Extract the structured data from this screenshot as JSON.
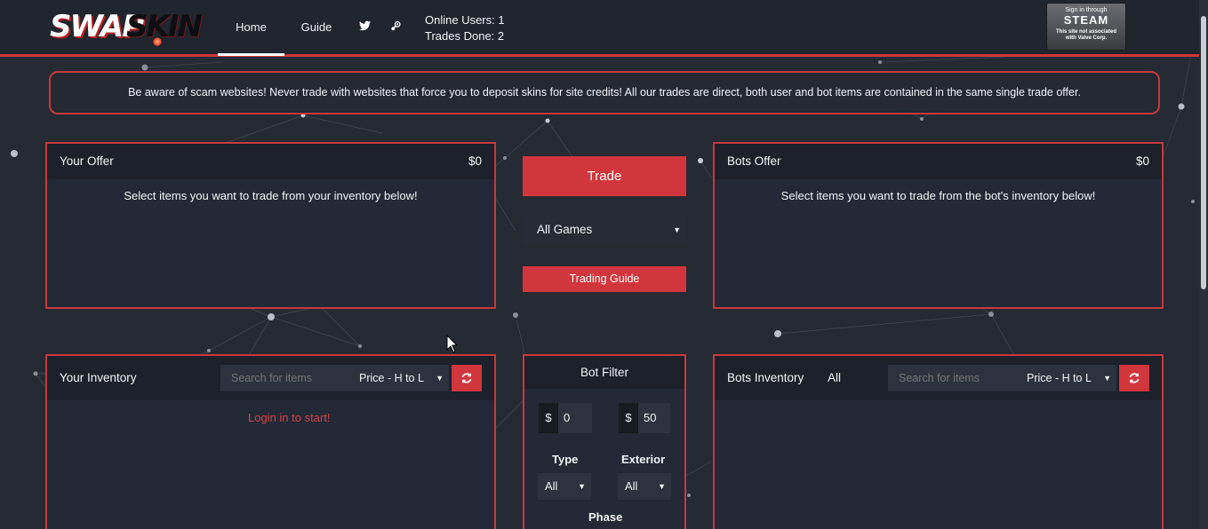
{
  "brand": {
    "logo_part_a": "SWAP",
    "logo_part_b": "SKIN"
  },
  "nav": {
    "home": "Home",
    "guide": "Guide",
    "twitter_icon": "twitter-icon",
    "steam_icon": "steam-icon"
  },
  "stats": {
    "online_users": "Online Users: 1",
    "trades_done": "Trades Done: 2"
  },
  "steam_login": {
    "line1": "Sign in through",
    "line2": "STEAM",
    "line3": "This site not associated",
    "line4": "with Valve Corp."
  },
  "warning": "Be aware of scam websites! Never trade with websites that force you to deposit skins for site credits! All our trades are direct, both user and bot items are contained in the same single trade offer.",
  "your_offer": {
    "title": "Your Offer",
    "amount": "$0",
    "message": "Select items you want to trade from your inventory below!"
  },
  "bots_offer": {
    "title": "Bots Offer",
    "amount": "$0",
    "message": "Select items you want to trade from the bot's inventory below!"
  },
  "middle": {
    "trade_button": "Trade",
    "games_select": "All Games",
    "trading_guide_button": "Trading Guide"
  },
  "your_inventory": {
    "title": "Your Inventory",
    "search_placeholder": "Search for items",
    "sort": "Price - H to L",
    "login_message": "Login in to start!"
  },
  "bot_filter": {
    "title": "Bot Filter",
    "currency": "$",
    "min_price": "0",
    "max_price": "50",
    "type_label": "Type",
    "type_value": "All",
    "exterior_label": "Exterior",
    "exterior_value": "All",
    "phase_label": "Phase"
  },
  "bots_inventory": {
    "title": "Bots Inventory",
    "filter_label": "All",
    "search_placeholder": "Search for items",
    "sort": "Price - H to L"
  },
  "colors": {
    "accent": "#d0363c",
    "background": "#262a33",
    "panel": "#232936",
    "link_red": "#d2444a"
  }
}
